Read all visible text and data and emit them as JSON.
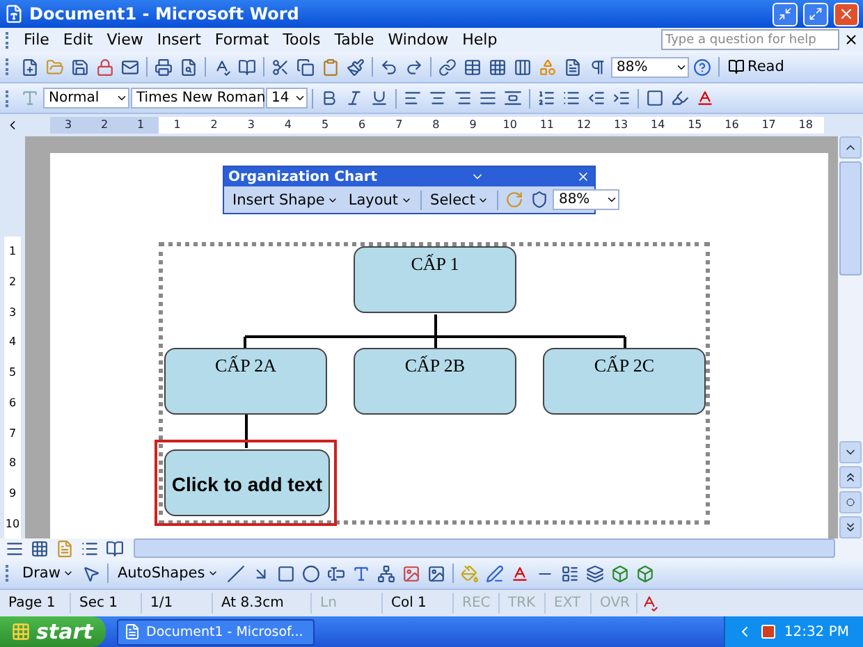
{
  "window": {
    "title": "Document1 - Microsoft Word"
  },
  "menu": [
    "File",
    "Edit",
    "View",
    "Insert",
    "Format",
    "Tools",
    "Table",
    "Window",
    "Help"
  ],
  "help_box": {
    "placeholder": "Type a question for help"
  },
  "standard_toolbar": {
    "zoom": "88%",
    "read_button": "Read"
  },
  "formatting_toolbar": {
    "style": "Normal",
    "font": "Times New Roman",
    "size": "14"
  },
  "ruler": {
    "left_labels": [
      "3",
      "2",
      "1"
    ],
    "right_labels": [
      "1",
      "2",
      "3",
      "4",
      "5",
      "6",
      "7",
      "8",
      "9",
      "10",
      "11",
      "12",
      "13",
      "14",
      "15",
      "16",
      "17",
      "18"
    ],
    "vertical_labels": [
      "1",
      "2",
      "3",
      "4",
      "5",
      "6",
      "7",
      "8",
      "9",
      "10"
    ]
  },
  "org_chart_toolbar": {
    "title": "Organization Chart",
    "buttons": [
      "Insert Shape",
      "Layout",
      "Select"
    ],
    "zoom": "88%"
  },
  "org_chart": {
    "label": "CẤP 1",
    "children": [
      {
        "label": "CẤP 2A",
        "children": [
          {
            "label": "Click to add text",
            "selected": true
          }
        ]
      },
      {
        "label": "CẤP 2B"
      },
      {
        "label": "CẤP 2C"
      }
    ]
  },
  "drawing_toolbar": {
    "draw": "Draw",
    "autoshapes": "AutoShapes"
  },
  "status_bar": [
    {
      "text": "Page 1",
      "disabled": false
    },
    {
      "text": "Sec 1",
      "disabled": false
    },
    {
      "text": "1/1",
      "disabled": false
    },
    {
      "text": "At 8.3cm",
      "disabled": false
    },
    {
      "text": "Ln",
      "disabled": true
    },
    {
      "text": "Col 1",
      "disabled": false
    }
  ],
  "indicators": [
    {
      "text": "REC",
      "disabled": true
    },
    {
      "text": "TRK",
      "disabled": true
    },
    {
      "text": "EXT",
      "disabled": true
    },
    {
      "text": "OVR",
      "disabled": true
    }
  ],
  "taskbar": {
    "start": "start",
    "tasks": [
      "Document1 - Microsof..."
    ],
    "clock": "12:32 PM"
  }
}
